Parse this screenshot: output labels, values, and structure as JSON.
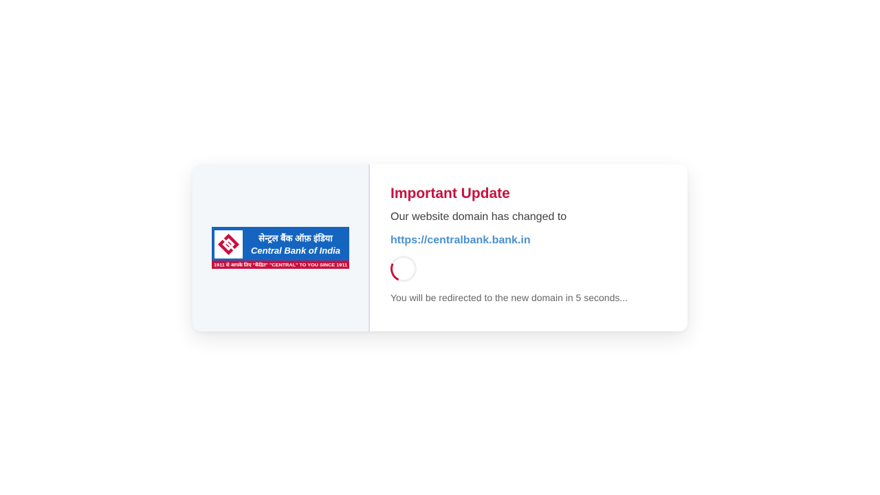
{
  "logo": {
    "hindi_text": "सेन्ट्रल बैंक ऑफ़ इंडिया",
    "english_text": "Central Bank of India",
    "tagline": "1911 से आपके लिए \"केंद्रित\" \"CENTRAL\" TO YOU SINCE 1911",
    "colors": {
      "blue": "#1565c0",
      "red": "#c8103e"
    }
  },
  "notice": {
    "title": "Important Update",
    "message": "Our website domain has changed to",
    "new_domain": "https://centralbank.bank.in",
    "redirect_note": "You will be redirected to the new domain in 5 seconds..."
  },
  "theme": {
    "accent": "#c8103e",
    "link": "#4a90d0"
  }
}
